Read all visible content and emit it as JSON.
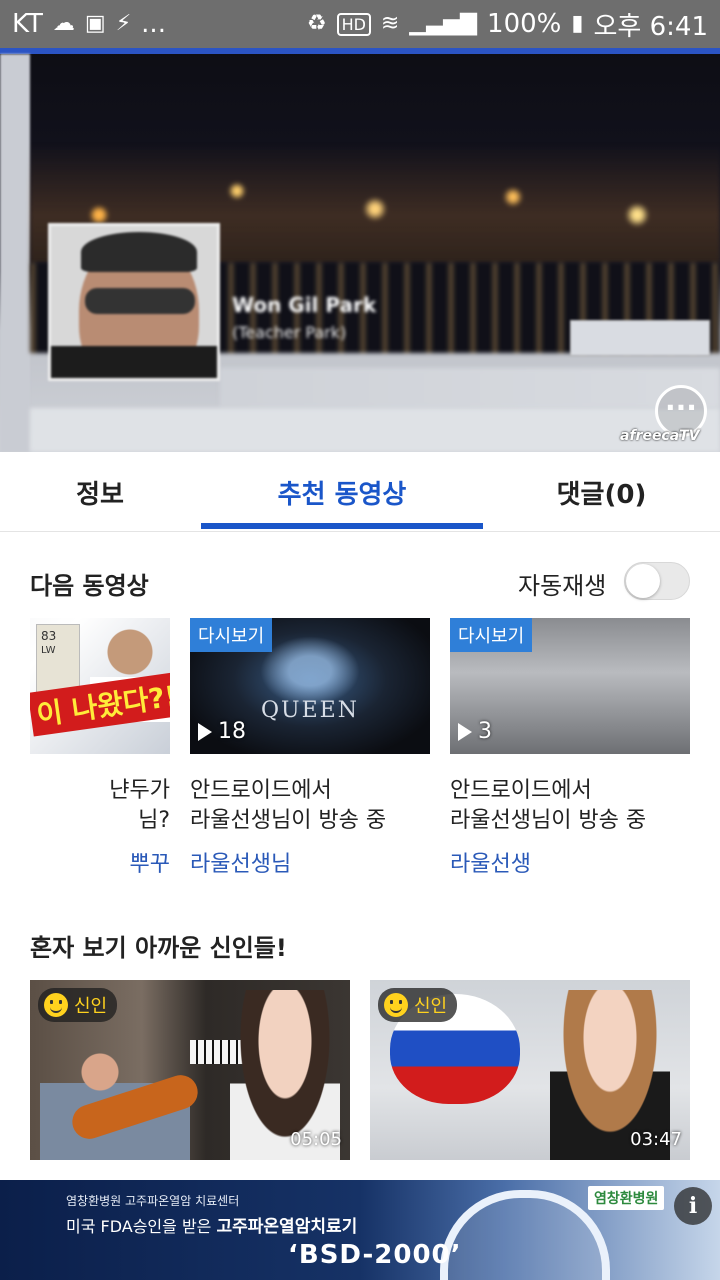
{
  "status_bar": {
    "carrier": "KT",
    "notifications": [
      "cloud-icon",
      "image-icon",
      "vlc-icon"
    ],
    "ellipsis": "...",
    "hd": "HD",
    "battery": "100%",
    "time": "오후 6:41"
  },
  "video": {
    "profile_name": "Won Gil Park",
    "profile_sub": "(Teacher Park)",
    "chat_label": "···",
    "brand": "afreecaTV"
  },
  "tabs": [
    {
      "label": "정보"
    },
    {
      "label": "추천 동영상"
    },
    {
      "label": "댓글(0)"
    }
  ],
  "next": {
    "header": "다음 동영상",
    "autoplay_label": "자동재생"
  },
  "video_cards": [
    {
      "badge": "",
      "count": "",
      "title": "냔두가\n님?",
      "author": "뿌꾸"
    },
    {
      "badge": "다시보기",
      "count": "18",
      "title": "안드로이드에서\n라울선생님이 방송 중",
      "author": "라울선생님"
    },
    {
      "badge": "다시보기",
      "count": "3",
      "title": "안드로이드에서\n라울선생님이 방송 중",
      "author": "라울선생"
    }
  ],
  "thumb_text": {
    "card1_rating": "83",
    "card1_pos": "LW",
    "card1_caption": "이 나왔다?!",
    "card2_caption": "QUEEN"
  },
  "rookies": {
    "header": "혼자 보기 아까운 신인들!",
    "items": [
      {
        "badge": "신인",
        "duration": "05:05"
      },
      {
        "badge": "신인",
        "duration": "03:47"
      }
    ]
  },
  "ad": {
    "line1": "염창환병원 고주파온열암 치료센터",
    "line2_prefix": "미국 FDA승인을 받은",
    "line2_bold": "고주파온열암치료기",
    "line3": "‘BSD-2000’",
    "logo": "염창환병원",
    "info": "i"
  }
}
